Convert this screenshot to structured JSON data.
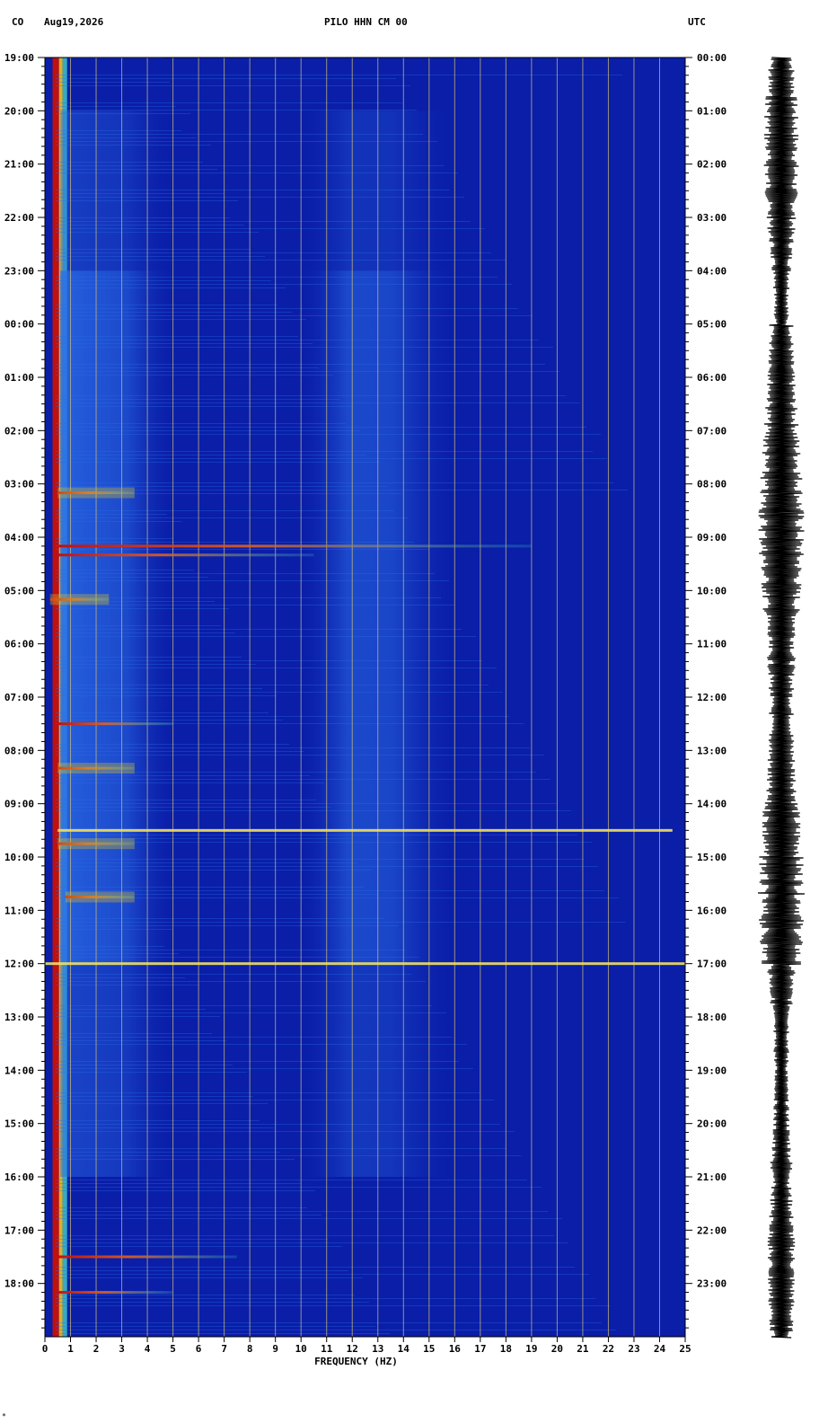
{
  "header": {
    "network": "CO",
    "date": "Aug19,2026",
    "channel": "PILO HHN CM 00",
    "timezone": "UTC"
  },
  "corner_mark": "*",
  "chart_data": {
    "type": "heatmap",
    "title": "PILO HHN CM 00",
    "xlabel": "FREQUENCY (HZ)",
    "xlim": [
      0,
      25
    ],
    "x_ticks": [
      "0",
      "1",
      "2",
      "3",
      "4",
      "5",
      "6",
      "7",
      "8",
      "9",
      "10",
      "11",
      "12",
      "13",
      "14",
      "15",
      "16",
      "17",
      "18",
      "19",
      "20",
      "21",
      "22",
      "23",
      "24",
      "25"
    ],
    "left_time_labels": [
      "19:00",
      "20:00",
      "21:00",
      "22:00",
      "23:00",
      "00:00",
      "01:00",
      "02:00",
      "03:00",
      "04:00",
      "05:00",
      "06:00",
      "07:00",
      "08:00",
      "09:00",
      "10:00",
      "11:00",
      "12:00",
      "13:00",
      "14:00",
      "15:00",
      "16:00",
      "17:00",
      "18:00"
    ],
    "right_time_labels": [
      "00:00",
      "01:00",
      "02:00",
      "03:00",
      "04:00",
      "05:00",
      "06:00",
      "07:00",
      "08:00",
      "09:00",
      "10:00",
      "11:00",
      "12:00",
      "13:00",
      "14:00",
      "15:00",
      "16:00",
      "17:00",
      "18:00",
      "19:00",
      "20:00",
      "21:00",
      "22:00",
      "23:00"
    ],
    "colors": {
      "background": "#0a1ea8",
      "grid": "#c8b878",
      "low": "#1030c0",
      "mid": "#2a6ce8",
      "high": "#40d0c8",
      "hot": "#c01010"
    },
    "energy_bands": [
      {
        "f_from": 0.3,
        "f_to": 0.55,
        "level": "hot",
        "note": "continuous low-frequency band"
      },
      {
        "f_from": 0.6,
        "f_to": 5.0,
        "level": "medium"
      },
      {
        "f_from": 10.0,
        "f_to": 16.0,
        "level": "medium"
      }
    ],
    "events": [
      {
        "hour": "03:10",
        "f_from": 0.5,
        "f_to": 3.5
      },
      {
        "hour": "04:10",
        "f_from": 0.5,
        "f_to": 19.0
      },
      {
        "hour": "04:20",
        "f_from": 0.5,
        "f_to": 10.5
      },
      {
        "hour": "05:10",
        "f_from": 0.2,
        "f_to": 2.5
      },
      {
        "hour": "07:30",
        "f_from": 0.5,
        "f_to": 5.0
      },
      {
        "hour": "08:20",
        "f_from": 0.5,
        "f_to": 3.5
      },
      {
        "hour": "09:30",
        "f_from": 0.5,
        "f_to": 24.5
      },
      {
        "hour": "09:45",
        "f_from": 0.5,
        "f_to": 3.5
      },
      {
        "hour": "10:45",
        "f_from": 0.8,
        "f_to": 3.5
      },
      {
        "hour": "12:00",
        "f_from": 0.0,
        "f_to": 25.0
      },
      {
        "hour": "17:30",
        "f_from": 0.5,
        "f_to": 7.5
      },
      {
        "hour": "18:10",
        "f_from": 0.5,
        "f_to": 5.0
      }
    ]
  }
}
